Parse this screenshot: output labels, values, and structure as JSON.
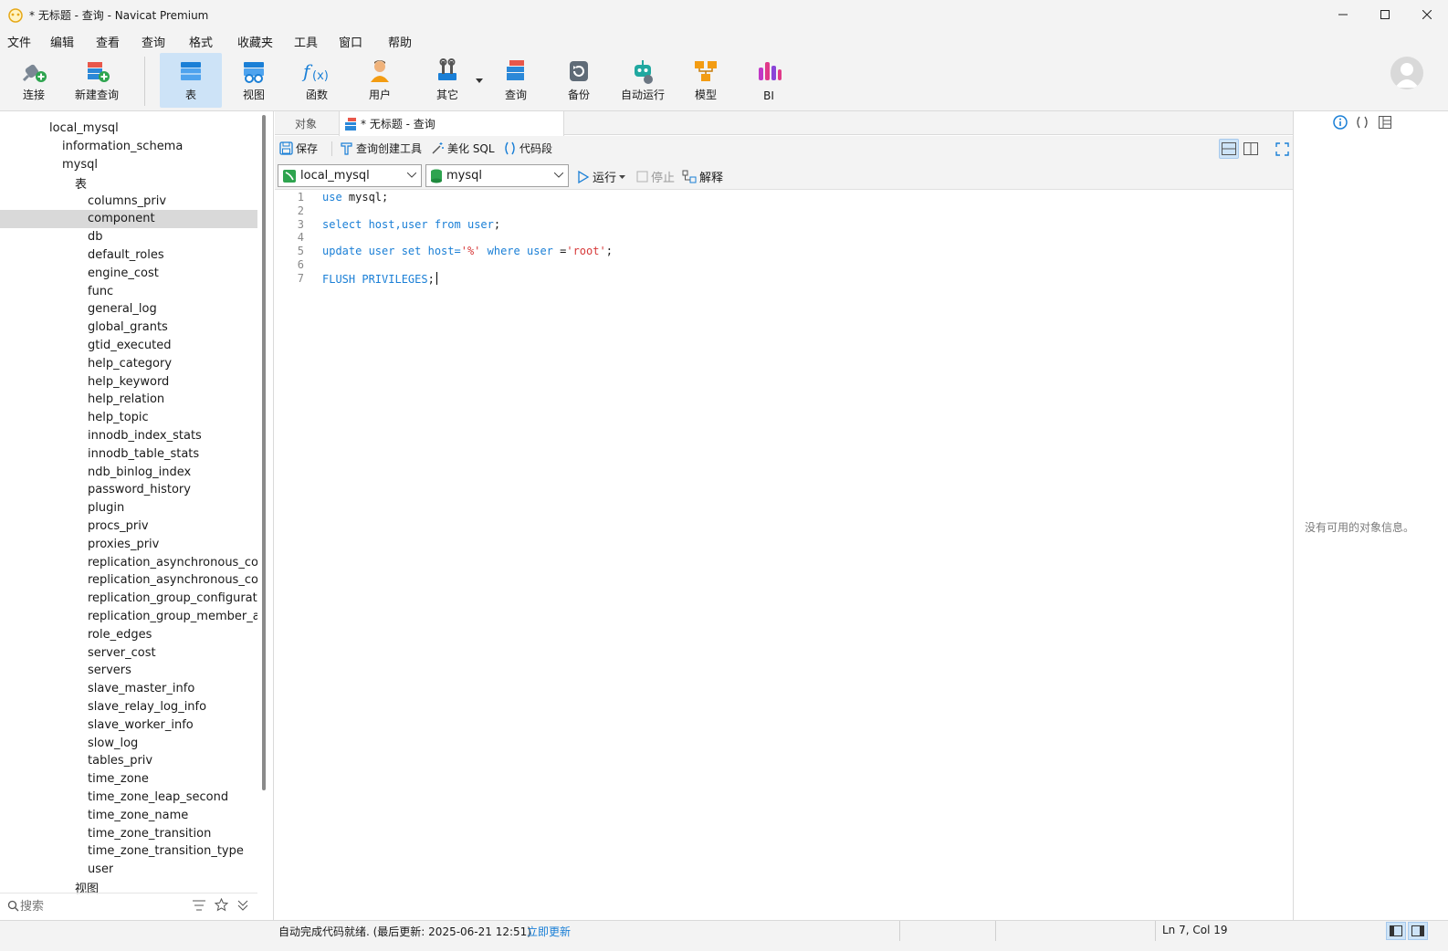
{
  "window": {
    "title": "* 无标题 - 查询 - Navicat Premium"
  },
  "menu": [
    "文件",
    "编辑",
    "查看",
    "查询",
    "格式",
    "收藏夹",
    "工具",
    "窗口",
    "帮助"
  ],
  "toolbar": {
    "connect": "连接",
    "new_query": "新建查询",
    "table": "表",
    "view": "视图",
    "function": "函数",
    "user": "用户",
    "others": "其它",
    "query": "查询",
    "backup": "备份",
    "auto_run": "自动运行",
    "model": "模型",
    "bi": "BI"
  },
  "tree": {
    "connection": "local_mysql",
    "db_info_schema": "information_schema",
    "db_mysql": "mysql",
    "tables_node": "表",
    "views_node": "视图",
    "selected": "component",
    "tables": [
      "columns_priv",
      "component",
      "db",
      "default_roles",
      "engine_cost",
      "func",
      "general_log",
      "global_grants",
      "gtid_executed",
      "help_category",
      "help_keyword",
      "help_relation",
      "help_topic",
      "innodb_index_stats",
      "innodb_table_stats",
      "ndb_binlog_index",
      "password_history",
      "plugin",
      "procs_priv",
      "proxies_priv",
      "replication_asynchronous_conne",
      "replication_asynchronous_conne",
      "replication_group_configuration_",
      "replication_group_member_actic",
      "role_edges",
      "server_cost",
      "servers",
      "slave_master_info",
      "slave_relay_log_info",
      "slave_worker_info",
      "slow_log",
      "tables_priv",
      "time_zone",
      "time_zone_leap_second",
      "time_zone_name",
      "time_zone_transition",
      "time_zone_transition_type",
      "user"
    ],
    "search_placeholder": "搜索"
  },
  "tabs": {
    "objects": "对象",
    "query_tab": "* 无标题 - 查询"
  },
  "query_toolbar": {
    "save": "保存",
    "query_builder": "查询创建工具",
    "beautify": "美化 SQL",
    "snippet": "代码段"
  },
  "selectors": {
    "connection": "local_mysql",
    "database": "mysql",
    "run": "运行",
    "stop": "停止",
    "explain": "解释"
  },
  "editor": {
    "lines": [
      {
        "n": "1",
        "segments": [
          {
            "t": "use",
            "c": "kw"
          },
          {
            "t": " mysql;",
            "c": ""
          }
        ]
      },
      {
        "n": "2",
        "segments": []
      },
      {
        "n": "3",
        "segments": [
          {
            "t": "select",
            "c": "kw"
          },
          {
            "t": " host,",
            "c": "kw"
          },
          {
            "t": "user",
            "c": "kw"
          },
          {
            "t": " from",
            "c": "kw"
          },
          {
            "t": " user",
            "c": "kw"
          },
          {
            "t": ";",
            "c": ""
          }
        ]
      },
      {
        "n": "4",
        "segments": []
      },
      {
        "n": "5",
        "segments": [
          {
            "t": "update user set host=",
            "c": "kw"
          },
          {
            "t": "'%'",
            "c": "str"
          },
          {
            "t": " where",
            "c": "kw"
          },
          {
            "t": " user",
            "c": "kw"
          },
          {
            "t": " =",
            "c": ""
          },
          {
            "t": "'root'",
            "c": "str"
          },
          {
            "t": ";",
            "c": ""
          }
        ]
      },
      {
        "n": "6",
        "segments": []
      },
      {
        "n": "7",
        "segments": [
          {
            "t": "FLUSH PRIVILEGES",
            "c": "kw"
          },
          {
            "t": ";",
            "c": ""
          }
        ]
      }
    ]
  },
  "info_panel": {
    "no_info": "没有可用的对象信息。"
  },
  "status": {
    "autocomplete": "自动完成代码就绪. (最后更新: 2025-06-21 12:51)",
    "update_now": "立即更新",
    "cursor_pos": "Ln 7, Col 19"
  },
  "colors": {
    "accent": "#1a7fd6",
    "selection": "#cde3f7",
    "string": "#d73a3a"
  }
}
